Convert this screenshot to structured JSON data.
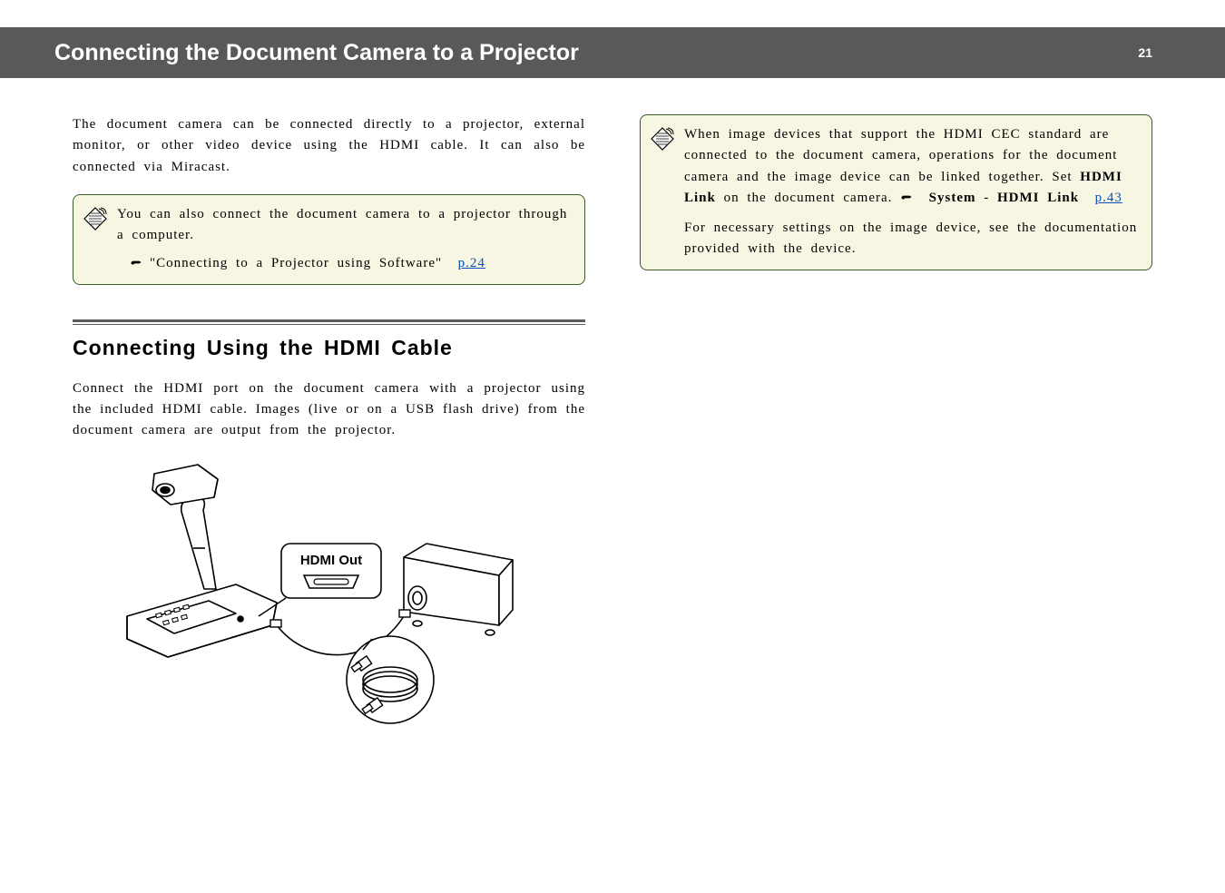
{
  "header": {
    "title": "Connecting the Document Camera to a Projector",
    "page": "21"
  },
  "left": {
    "intro": "The document camera can be connected directly to a projector, external monitor, or other video device using the HDMI cable. It can also be connected via Miracast.",
    "note1": "You can also connect the document camera to a projector through a computer.",
    "note1_link_label": "\"Connecting to a Projector using Software\"",
    "note1_link_page": "p.24",
    "section_heading": "Connecting Using the HDMI Cable",
    "section_body": "Connect the HDMI port on the document camera with a projector using the included HDMI cable. Images (live or on a USB flash drive) from the document camera are output from the projector.",
    "diagram_label": "HDMI Out"
  },
  "right": {
    "note_p1_pre": "When image devices that support the HDMI CEC standard are connected to the document camera, operations for the document camera and the image device can be linked together. Set ",
    "note_p1_bold1": "HDMI Link",
    "note_p1_mid": " on the document camera. ",
    "note_p1_menu_system": "System",
    "note_p1_dash": " - ",
    "note_p1_menu_link": "HDMI Link",
    "note_p1_page": "p.43",
    "note_p2": "For necessary settings on the image device, see the documentation provided with the device."
  }
}
